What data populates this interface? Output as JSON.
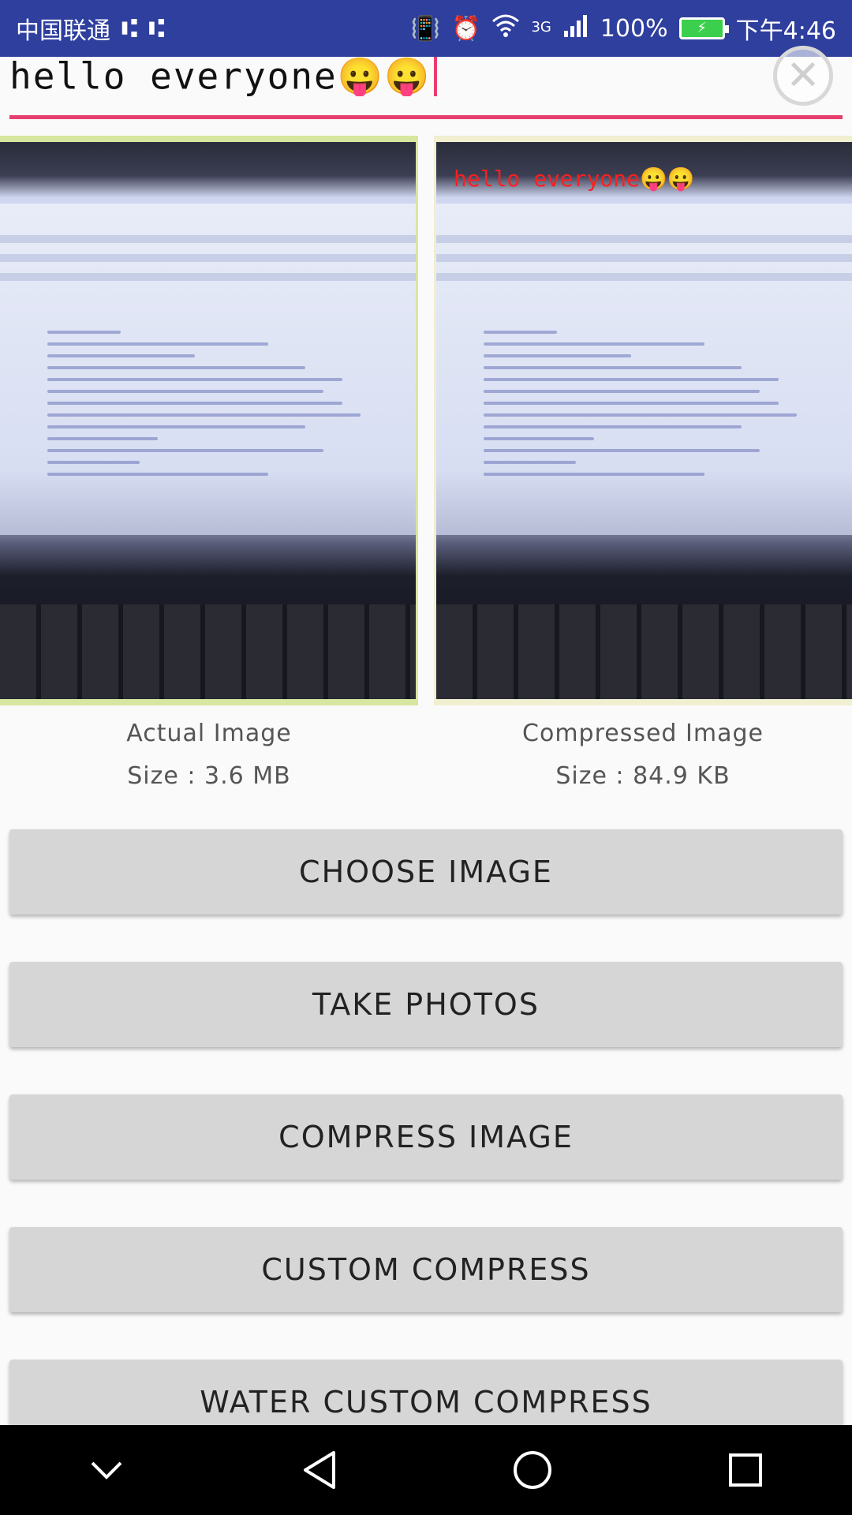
{
  "status_bar": {
    "carrier": "中国联通",
    "usb_icons": [
      "usb-icon",
      "usb-icon"
    ],
    "network": "3G",
    "battery_percent": "100%",
    "time": "下午4:46"
  },
  "edit": {
    "text": "hello everyone😛😛"
  },
  "images": {
    "actual_label": "Actual Image",
    "actual_size": "Size : 3.6 MB",
    "compressed_label": "Compressed Image",
    "compressed_size": "Size : 84.9 KB",
    "watermark_text": "hello everyone😛😛"
  },
  "buttons": {
    "choose_image": "CHOOSE IMAGE",
    "take_photos": "TAKE PHOTOS",
    "compress_image": "COMPRESS IMAGE",
    "custom_compress": "CUSTOM COMPRESS",
    "water_custom_compress": "WATER CUSTOM COMPRESS"
  },
  "nav": {
    "icons": [
      "chevron-down-icon",
      "back-icon",
      "home-icon",
      "recents-icon"
    ]
  },
  "colors": {
    "status_bar": "#2f3f9e",
    "accent": "#e83e6e",
    "button_bg": "#d6d6d6"
  }
}
